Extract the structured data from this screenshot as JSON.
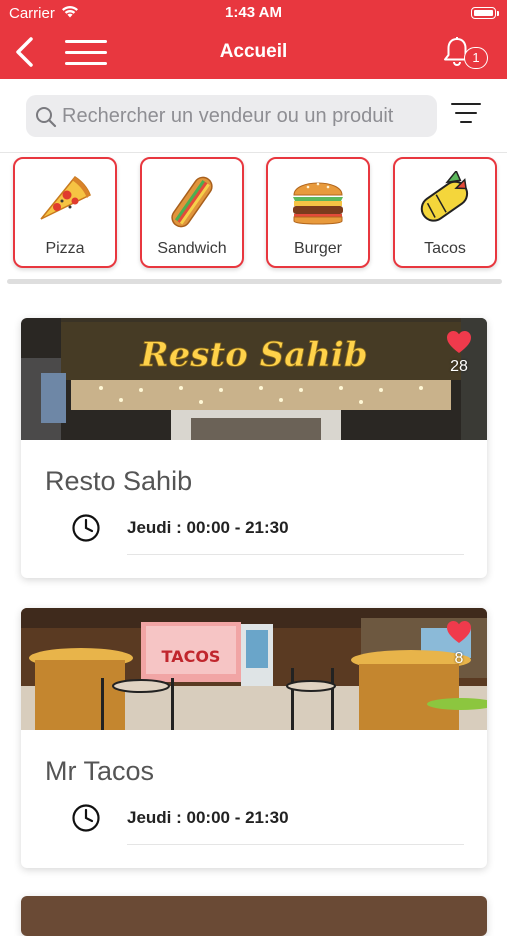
{
  "status": {
    "carrier": "Carrier",
    "time": "1:43 AM"
  },
  "nav": {
    "title": "Accueil",
    "notification_count": "1"
  },
  "search": {
    "placeholder": "Rechercher un vendeur ou un produit"
  },
  "categories": [
    {
      "label": "Pizza",
      "icon": "pizza-icon"
    },
    {
      "label": "Sandwich",
      "icon": "sandwich-icon"
    },
    {
      "label": "Burger",
      "icon": "burger-icon"
    },
    {
      "label": "Tacos",
      "icon": "tacos-icon"
    }
  ],
  "restaurants": [
    {
      "name": "Resto Sahib",
      "sign_text": "Resto Sahib",
      "likes": "28",
      "hours": "Jeudi : 00:00 - 21:30"
    },
    {
      "name": "Mr Tacos",
      "sign_text": "TACOS",
      "likes": "8",
      "hours": "Jeudi : 00:00 - 21:30"
    }
  ],
  "colors": {
    "brand": "#e8373f",
    "heart": "#f03a4c"
  }
}
